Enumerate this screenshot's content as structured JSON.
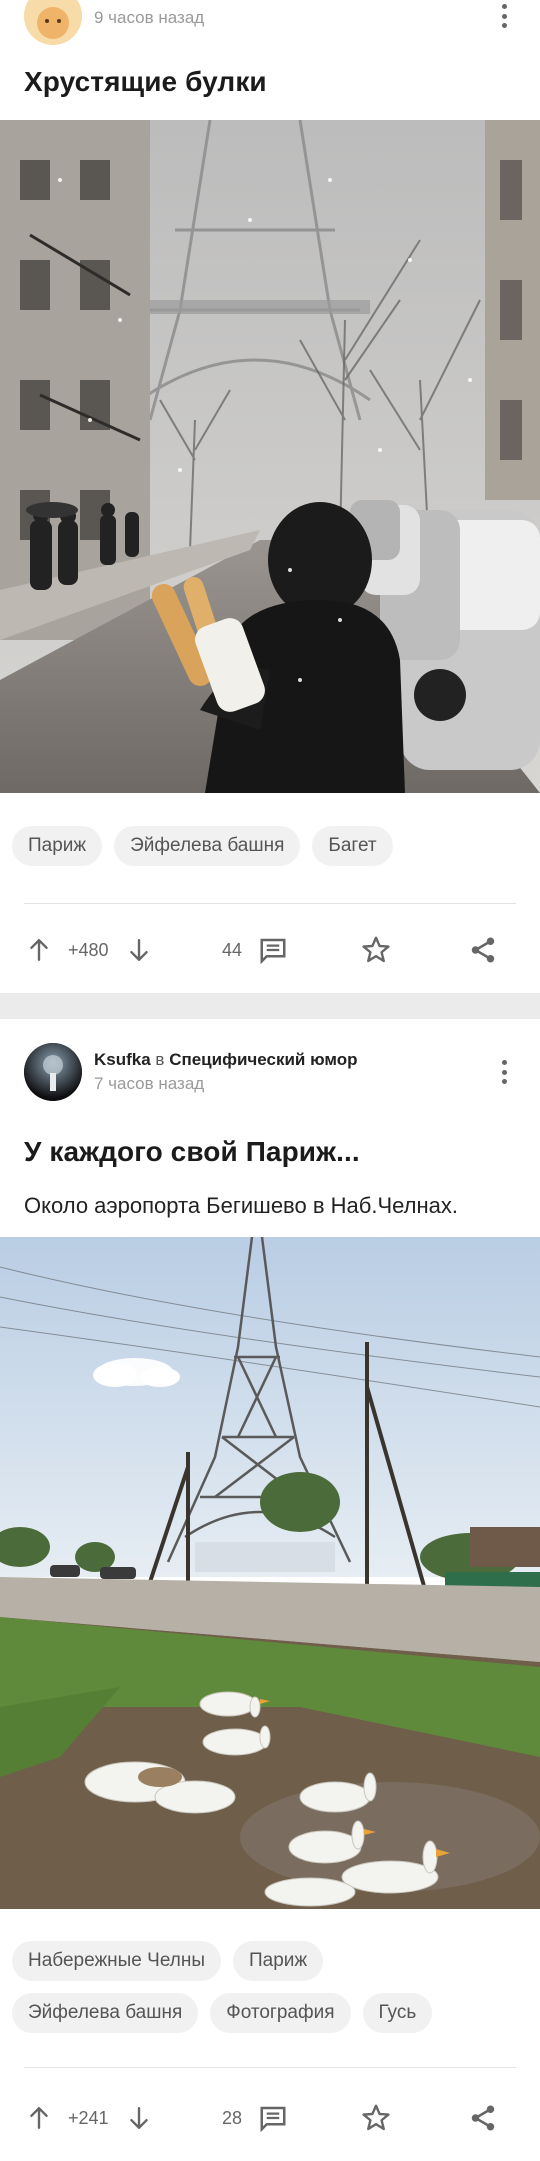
{
  "post1": {
    "time": "9 часов назад",
    "title": "Хрустящие булки",
    "tags": [
      "Париж",
      "Эйфелева башня",
      "Багет"
    ],
    "rating": "+480",
    "comments": "44"
  },
  "post2": {
    "author": "Ksufka",
    "in_word": "в",
    "community": "Специфический юмор",
    "time": "7 часов назад",
    "title": "У каждого свой Париж...",
    "description": "Около аэропорта Бегишево в Наб.Челнах.",
    "tags": [
      "Набережные Челны",
      "Париж",
      "Эйфелева башня",
      "Фотография",
      "Гусь"
    ],
    "rating": "+241",
    "comments": "28"
  },
  "colors": {
    "icon_grey": "#666666",
    "tag_bg": "#f1f1f1",
    "page_bg": "#ebebeb"
  },
  "icons": [
    "upvote-arrow-icon",
    "downvote-arrow-icon",
    "comment-icon",
    "star-icon",
    "share-icon",
    "more-vert-icon"
  ]
}
